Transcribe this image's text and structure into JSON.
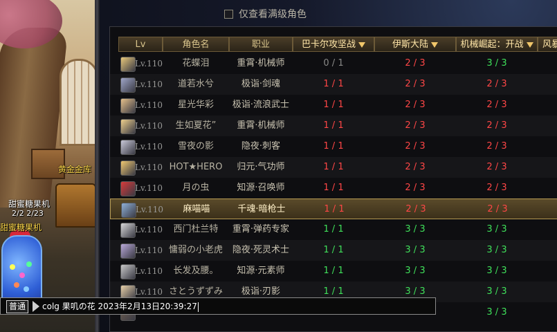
{
  "filter": {
    "label": "仅查看满级角色",
    "checked": false
  },
  "table": {
    "headers": [
      "Lv",
      "角色名",
      "职业",
      "巴卡尔攻坚战",
      "伊斯大陆",
      "机械崛起：开战",
      "风暴"
    ],
    "rows": [
      {
        "lv": "Lv.110",
        "name": "花蝶泪",
        "job": "重霄·机械师",
        "c1": "0 / 1",
        "c2": "2 / 3",
        "c3": "3 / 3",
        "avatar": "#e8c87a"
      },
      {
        "lv": "Lv.110",
        "name": "道若水兮",
        "job": "极诣·剑魂",
        "c1": "1 / 1",
        "c2": "2 / 3",
        "c3": "2 / 3",
        "avatar": "#9fa6c8"
      },
      {
        "lv": "Lv.110",
        "name": "星光华彩",
        "job": "极诣·流浪武士",
        "c1": "1 / 1",
        "c2": "2 / 3",
        "c3": "2 / 3",
        "avatar": "#e6c08a"
      },
      {
        "lv": "Lv.110",
        "name": "生如夏花”",
        "job": "重霄·机械师",
        "c1": "1 / 1",
        "c2": "2 / 3",
        "c3": "2 / 3",
        "avatar": "#efd08c"
      },
      {
        "lv": "Lv.110",
        "name": "雪夜の影",
        "job": "隐夜·刺客",
        "c1": "1 / 1",
        "c2": "2 / 3",
        "c3": "2 / 3",
        "avatar": "#c8c8d8"
      },
      {
        "lv": "Lv.110",
        "name": "HOT★HERO",
        "job": "归元·气功师",
        "c1": "1 / 1",
        "c2": "2 / 3",
        "c3": "2 / 3",
        "avatar": "#f0c870"
      },
      {
        "lv": "Lv.110",
        "name": "月の虫",
        "job": "知源·召唤师",
        "c1": "1 / 1",
        "c2": "2 / 3",
        "c3": "2 / 3",
        "avatar": "#d83a3a"
      },
      {
        "lv": "Lv.110",
        "name": "麻喵喵",
        "job": "千魂·暗枪士",
        "c1": "1 / 1",
        "c2": "2 / 3",
        "c3": "2 / 3",
        "avatar": "#8fb0d8",
        "selected": true
      },
      {
        "lv": "Lv.110",
        "name": "西门杜兰特",
        "job": "重霄·弹药专家",
        "c1": "1 / 1",
        "c2": "3 / 3",
        "c3": "3 / 3",
        "avatar": "#d8d8d8"
      },
      {
        "lv": "Lv.110",
        "name": "慵弱の小老虎",
        "job": "隐夜·死灵术士",
        "c1": "1 / 1",
        "c2": "3 / 3",
        "c3": "3 / 3",
        "avatar": "#b8a8d8"
      },
      {
        "lv": "Lv.110",
        "name": "长发及腰。",
        "job": "知源·元素师",
        "c1": "1 / 1",
        "c2": "3 / 3",
        "c3": "3 / 3",
        "avatar": "#c8c8c8"
      },
      {
        "lv": "Lv.110",
        "name": "さとうずずみ",
        "job": "极诣·刃影",
        "c1": "1 / 1",
        "c2": "3 / 3",
        "c3": "3 / 3",
        "avatar": "#e8d0a8"
      },
      {
        "lv": "",
        "name": "",
        "job": "",
        "c1": "",
        "c2": "",
        "c3": "3 / 3",
        "avatar": "#706050"
      }
    ]
  },
  "scene": {
    "npc1": "黄金金库",
    "npc2_title": "甜蜜糖果机",
    "npc2_count": "2/2  2/23",
    "npc3": "甜蜜糖果机"
  },
  "chat": {
    "channel": "普通",
    "text": "colg 果叽の花 2023年2月13日20:39:27"
  },
  "colors": {
    "red": "#ff4646",
    "green": "#3fe05a",
    "gray": "#8a8a88",
    "header_text": "#d9c58c"
  }
}
